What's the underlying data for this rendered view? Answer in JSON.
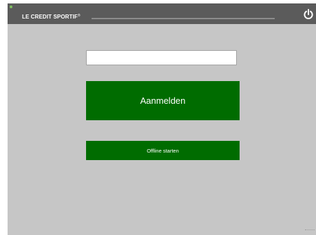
{
  "header": {
    "brand": "LE CREDIT SPORTIF",
    "brand_mark": "®",
    "power_icon": "power-icon"
  },
  "login": {
    "input_value": "",
    "input_placeholder": "",
    "login_button_label": "Aanmelden",
    "offline_button_label": "Offline starten"
  },
  "colors": {
    "topbar": "#5b5b5b",
    "background": "#c6c6c6",
    "button_green": "#006c00",
    "text_white": "#ffffff"
  }
}
